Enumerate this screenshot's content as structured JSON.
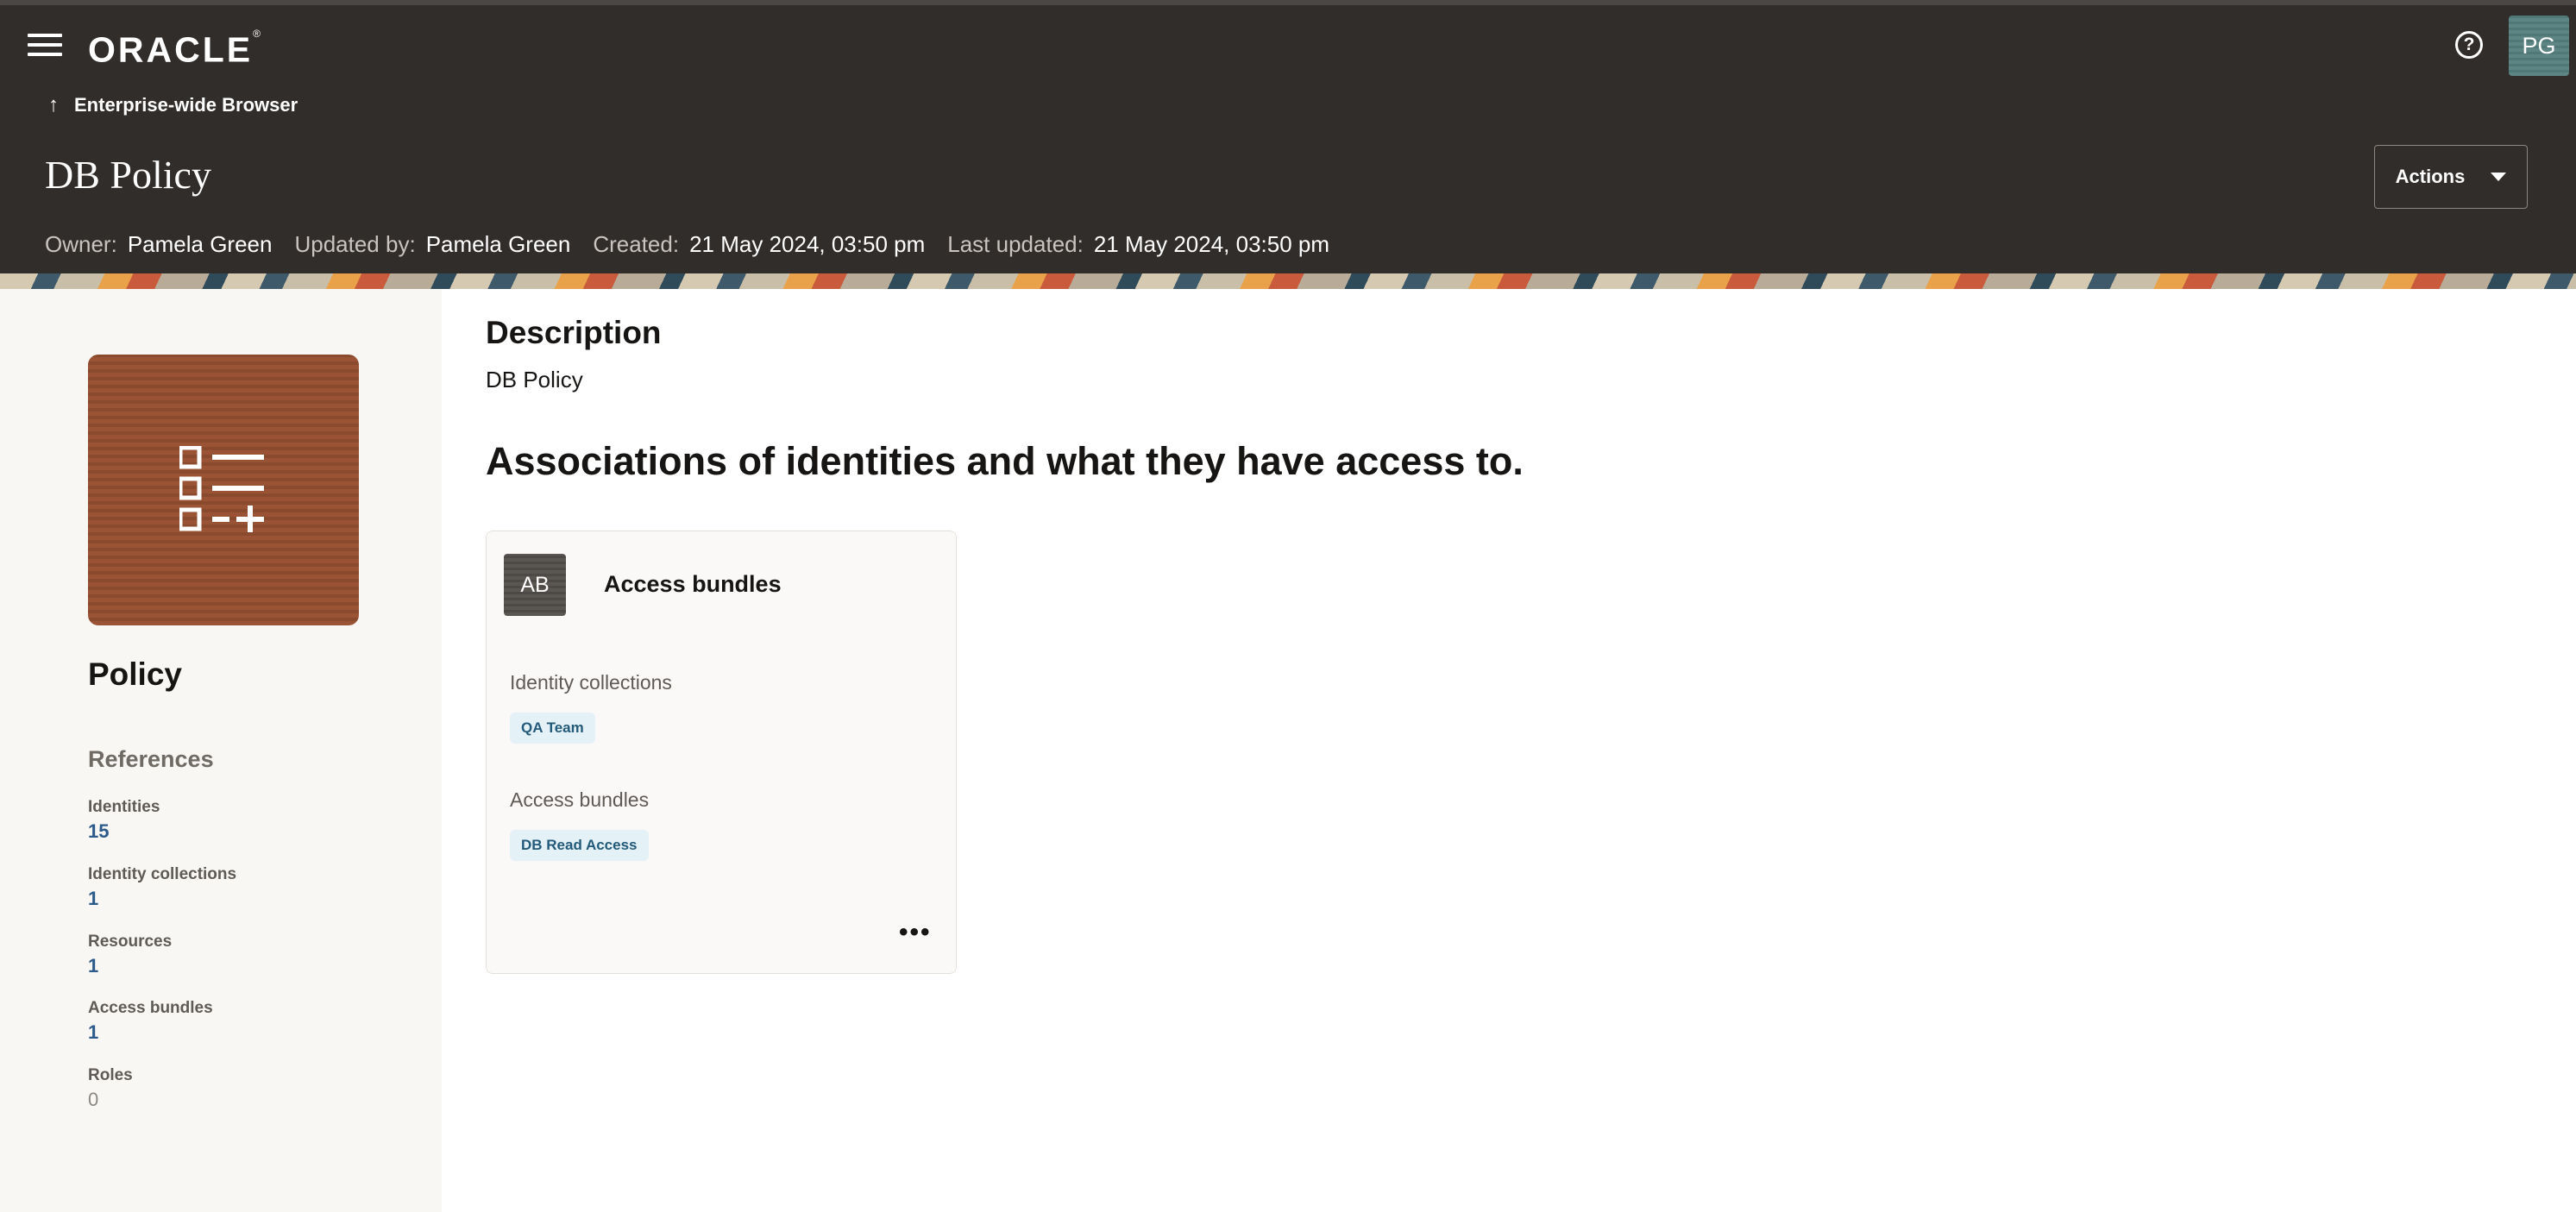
{
  "app": {
    "logo": "ORACLE",
    "logo_mark": "®"
  },
  "header": {
    "back_label": "Enterprise-wide Browser",
    "title": "DB Policy",
    "actions_label": "Actions",
    "help_glyph": "?",
    "avatar_initials": "PG",
    "meta": [
      {
        "key": "Owner:",
        "value": "Pamela Green"
      },
      {
        "key": "Updated by:",
        "value": "Pamela Green"
      },
      {
        "key": "Created:",
        "value": "21 May 2024, 03:50 pm"
      },
      {
        "key": "Last updated:",
        "value": "21 May 2024, 03:50 pm"
      }
    ]
  },
  "sidebar": {
    "type_label": "Policy",
    "references_title": "References",
    "references": [
      {
        "label": "Identities",
        "count": "15"
      },
      {
        "label": "Identity collections",
        "count": "1"
      },
      {
        "label": "Resources",
        "count": "1"
      },
      {
        "label": "Access bundles",
        "count": "1"
      },
      {
        "label": "Roles",
        "count": "0"
      }
    ]
  },
  "main": {
    "description_heading": "Description",
    "description_text": "DB Policy",
    "associations_heading": "Associations of identities and what they have access to.",
    "card": {
      "badge": "AB",
      "title": "Access bundles",
      "identity_collections_label": "Identity collections",
      "identity_collections_chip": "QA Team",
      "access_bundles_label": "Access bundles",
      "access_bundles_chip": "DB Read Access",
      "more_glyph": "•••"
    }
  },
  "colors": {
    "header_bg": "#312d2a",
    "sidebar_bg": "#f8f7f4",
    "link": "#2c5a8a",
    "chip_bg": "#e4f1f7"
  }
}
